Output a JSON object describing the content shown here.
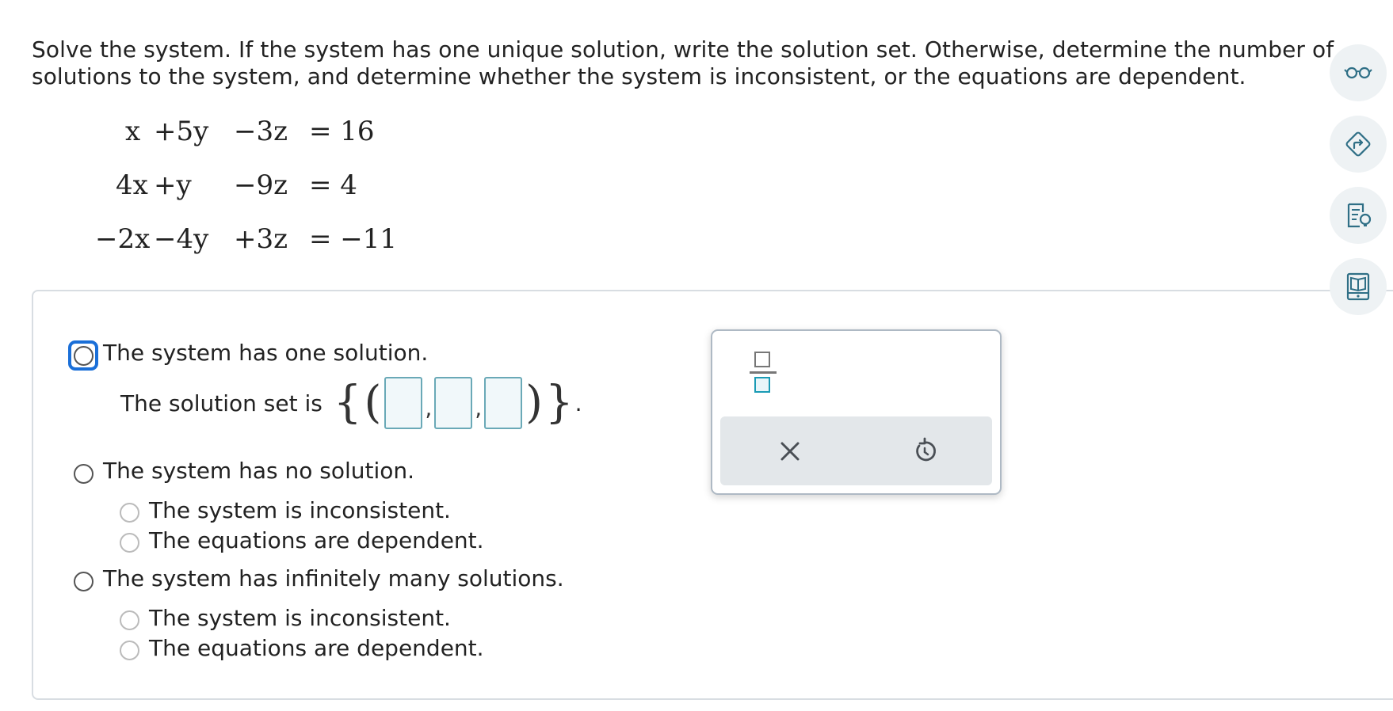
{
  "prompt": {
    "line1": "Solve the system. If the system has one unique solution, write the solution set. Otherwise, determine the number of",
    "line2": "solutions to the system, and determine whether the system is inconsistent, or the equations are dependent."
  },
  "equations": [
    {
      "x": "x",
      "y": "+5y",
      "z": "−3z",
      "rhs": "= 16"
    },
    {
      "x": "4x",
      "y": "+y",
      "z": "−9z",
      "rhs": "= 4"
    },
    {
      "x": "−2x",
      "y": "−4y",
      "z": "+3z",
      "rhs": "= −11"
    }
  ],
  "options": {
    "one_solution": "The system has one solution.",
    "solution_set_label": "The solution set is",
    "set_open": "{",
    "set_close": "}",
    "paren_open": "(",
    "paren_close": ")",
    "comma": ",",
    "period": ".",
    "no_solution": "The system has no solution.",
    "no_solution_sub": [
      "The system is inconsistent.",
      "The equations are dependent."
    ],
    "infinite": "The system has infinitely many solutions.",
    "infinite_sub": [
      "The system is inconsistent.",
      "The equations are dependent."
    ]
  },
  "solution_inputs": [
    "",
    "",
    ""
  ],
  "palette": {
    "fraction_icon": "fraction-icon",
    "clear_icon": "close-icon",
    "undo_icon": "undo-icon"
  },
  "side_tools": [
    "glasses-icon",
    "directions-icon",
    "reading-lightbulb-icon",
    "book-icon"
  ],
  "colors": {
    "focus": "#1a6fd8",
    "input_border": "#6aa9b7",
    "tool_bg": "#eef2f4",
    "icon": "#2f6f86"
  }
}
